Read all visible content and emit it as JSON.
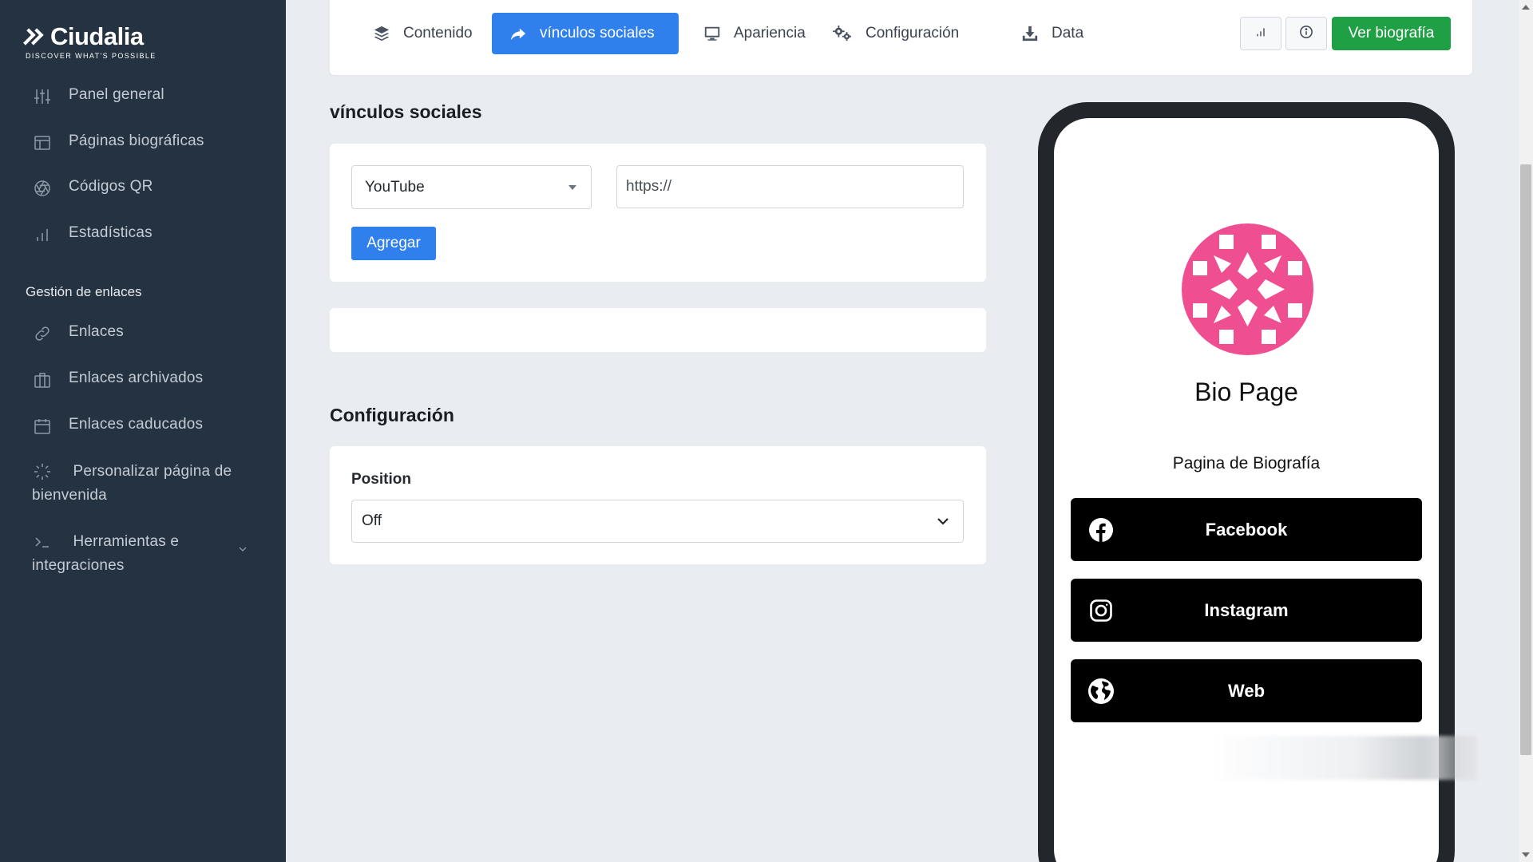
{
  "brand": {
    "name": "Ciudalia",
    "tagline": "DISCOVER WHAT'S POSSIBLE"
  },
  "sidebar": {
    "items": [
      {
        "label": "Panel general",
        "icon": "sliders-icon"
      },
      {
        "label": "Páginas biográficas",
        "icon": "layout-icon"
      },
      {
        "label": "Códigos QR",
        "icon": "aperture-icon"
      },
      {
        "label": "Estadísticas",
        "icon": "bar-chart-icon"
      }
    ],
    "section_title": "Gestión de enlaces",
    "link_items": [
      {
        "label": "Enlaces",
        "icon": "link-icon"
      },
      {
        "label": "Enlaces archivados",
        "icon": "briefcase-icon"
      },
      {
        "label": "Enlaces caducados",
        "icon": "calendar-icon"
      },
      {
        "label": "Personalizar página de bienvenida",
        "icon": "loader-icon"
      },
      {
        "label": "Herramientas e integraciones",
        "icon": "terminal-icon"
      }
    ]
  },
  "tabs": [
    {
      "label": "Contenido",
      "icon": "layers-icon",
      "active": false
    },
    {
      "label": "vínculos sociales",
      "icon": "share-icon",
      "active": true
    },
    {
      "label": "Apariencia",
      "icon": "monitor-icon",
      "active": false
    },
    {
      "label": "Configuración",
      "icon": "cogs-icon",
      "active": false
    },
    {
      "label": "Data",
      "icon": "download-icon",
      "active": false
    }
  ],
  "toolbar": {
    "view_label": "Ver biografía",
    "stats_icon": "bar-chart-icon",
    "info_icon": "info-icon"
  },
  "social": {
    "title": "vínculos sociales",
    "platform_value": "YouTube",
    "url_placeholder": "https://",
    "add_label": "Agregar"
  },
  "settings": {
    "title": "Configuración",
    "position_label": "Position",
    "position_value": "Off"
  },
  "preview": {
    "name": "Bio Page",
    "description": "Pagina de Biografía",
    "links": [
      {
        "label": "Facebook",
        "icon": "facebook-icon"
      },
      {
        "label": "Instagram",
        "icon": "instagram-icon"
      },
      {
        "label": "Web",
        "icon": "globe-icon"
      }
    ]
  },
  "colors": {
    "sidebar": "#253241",
    "primary": "#2f80ed",
    "success": "#1fa045",
    "avatar": "#ef4f91"
  }
}
